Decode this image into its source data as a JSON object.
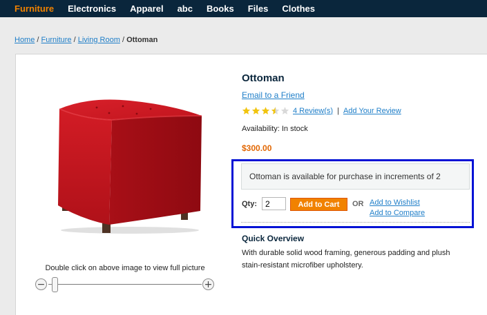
{
  "nav": {
    "items": [
      {
        "label": "Furniture",
        "active": true
      },
      {
        "label": "Electronics"
      },
      {
        "label": "Apparel"
      },
      {
        "label": "abc"
      },
      {
        "label": "Books"
      },
      {
        "label": "Files"
      },
      {
        "label": "Clothes"
      }
    ]
  },
  "breadcrumb": {
    "home": "Home",
    "furniture": "Furniture",
    "living_room": "Living Room",
    "current": "Ottoman",
    "separator": "/"
  },
  "image": {
    "caption": "Double click on above image to view full picture",
    "zoom_minus": "−",
    "zoom_plus": "+",
    "zoom_level": 0
  },
  "product": {
    "name": "Ottoman",
    "email_link": "Email to a Friend",
    "rating": 3.5,
    "reviews_link": "4 Review(s)",
    "ratings_separator": "|",
    "add_review_link": "Add Your Review",
    "availability": "Availability: In stock",
    "price": "$300.00",
    "notice": "Ottoman is available for purchase in increments of 2",
    "qty_label": "Qty:",
    "qty_value": "2",
    "add_to_cart": "Add to Cart",
    "or_label": "OR",
    "wishlist_link": "Add to Wishlist",
    "compare_link": "Add to Compare",
    "overview_title": "Quick Overview",
    "overview_text": "With durable solid wood framing, generous padding and plush stain-resistant microfiber upholstery."
  },
  "colors": {
    "nav_bg": "#0a263c",
    "accent": "#f18200",
    "link": "#1e7ec8",
    "highlight_border": "#0011d5",
    "star_fill": "#f1c40f"
  }
}
